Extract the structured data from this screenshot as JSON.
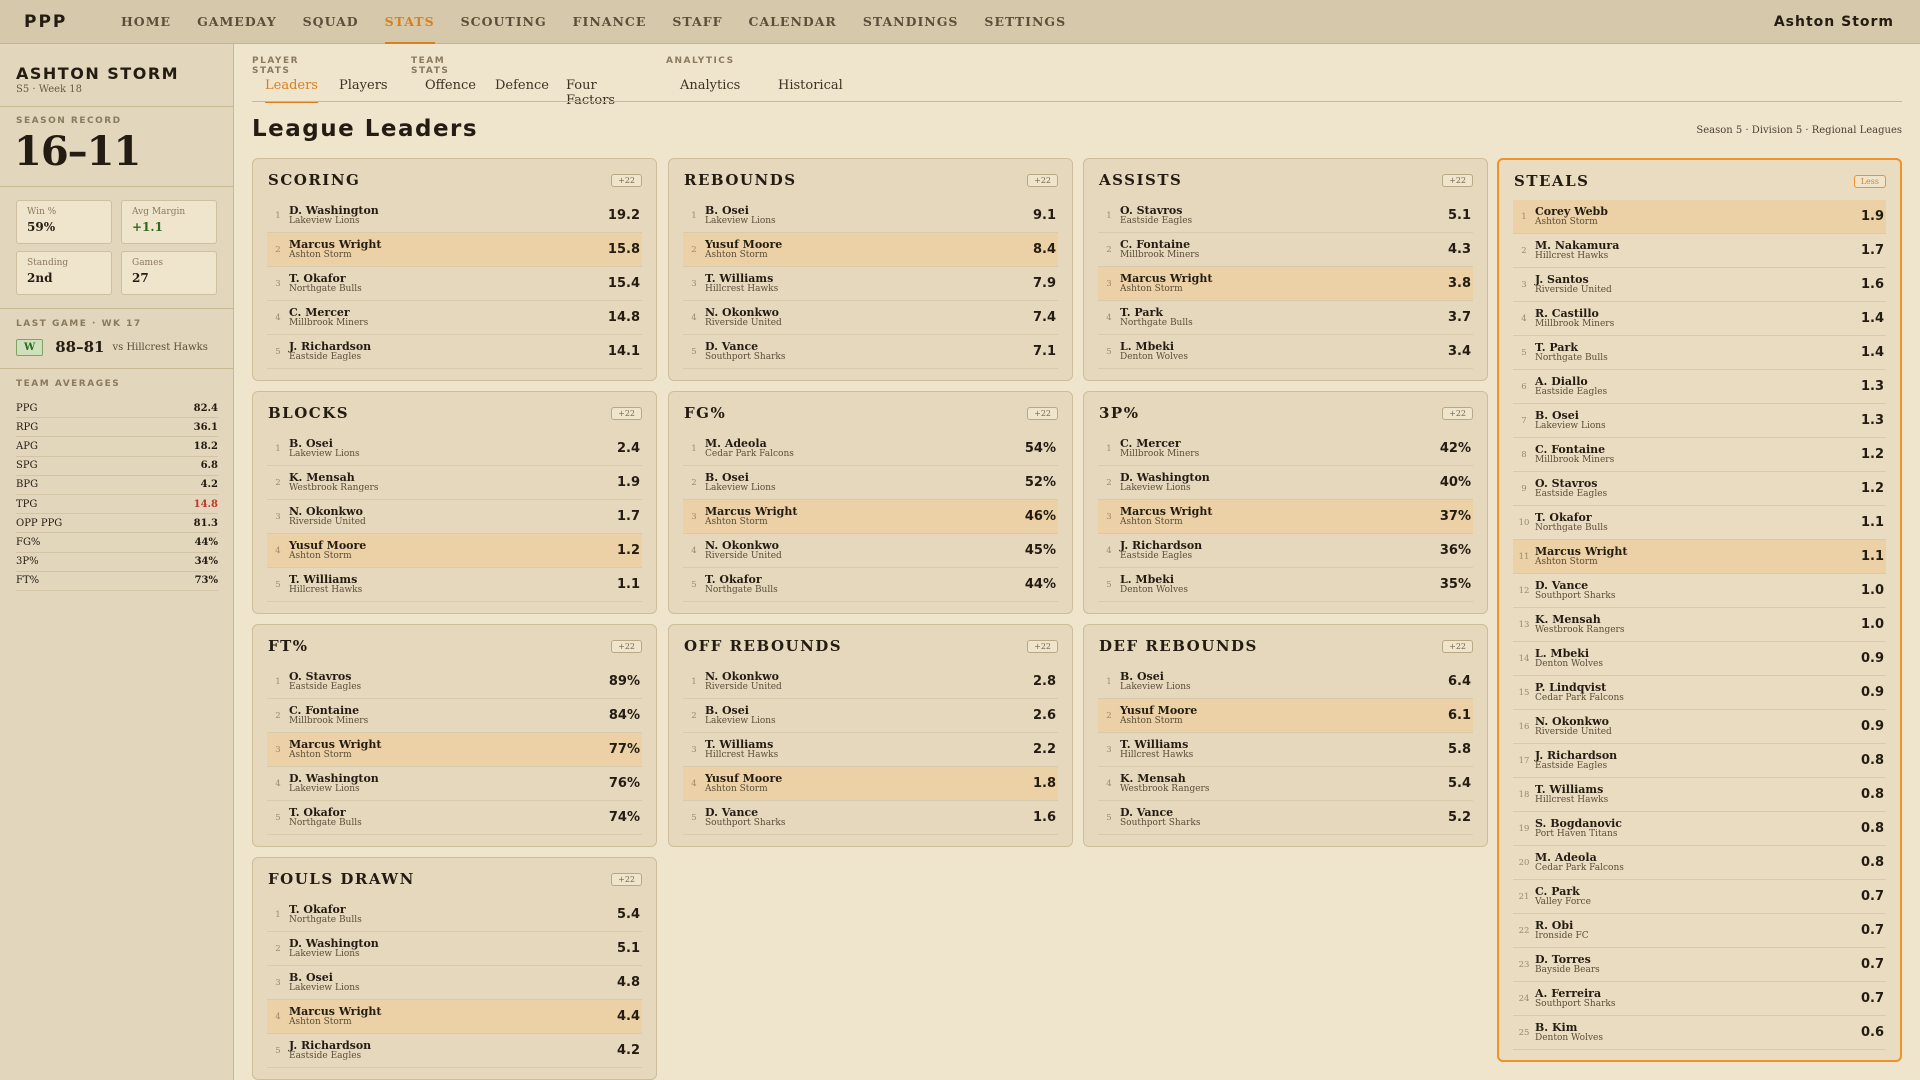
{
  "app": {
    "logo": "PPP",
    "user": "Ashton Storm"
  },
  "nav": [
    "HOME",
    "GAMEDAY",
    "SQUAD",
    "STATS",
    "SCOUTING",
    "FINANCE",
    "STAFF",
    "CALENDAR",
    "STANDINGS",
    "SETTINGS"
  ],
  "sidebar": {
    "team": "ASHTON STORM",
    "sub": "S5 · Week 18",
    "record_label": "SEASON RECORD",
    "record": "16–11",
    "stats": [
      {
        "label": "Win %",
        "value": "59%"
      },
      {
        "label": "Avg Margin",
        "value": "+1.1"
      },
      {
        "label": "Standing",
        "value": "2nd"
      },
      {
        "label": "Games",
        "value": "27"
      }
    ],
    "last_game_label": "LAST GAME · WK 17",
    "last_game": {
      "result": "W",
      "score": "88–81",
      "opponent": "vs Hillcrest Hawks"
    },
    "averages_label": "TEAM AVERAGES",
    "averages": [
      {
        "k": "PPG",
        "v": "82.4"
      },
      {
        "k": "RPG",
        "v": "36.1"
      },
      {
        "k": "APG",
        "v": "18.2"
      },
      {
        "k": "SPG",
        "v": "6.8"
      },
      {
        "k": "BPG",
        "v": "4.2"
      },
      {
        "k": "TPG",
        "v": "14.8"
      },
      {
        "k": "OPP PPG",
        "v": "81.3"
      },
      {
        "k": "FG%",
        "v": "44%"
      },
      {
        "k": "3P%",
        "v": "34%"
      },
      {
        "k": "FT%",
        "v": "73%"
      }
    ]
  },
  "tabs": {
    "groups": [
      "PLAYER STATS",
      "TEAM STATS",
      "ANALYTICS"
    ],
    "items": [
      "Leaders",
      "Players",
      "Offence",
      "Defence",
      "Four Factors",
      "Analytics",
      "Historical"
    ]
  },
  "page": {
    "title": "League Leaders",
    "breadcrumb": "Season 5 · Division 5 · Regional Leagues"
  },
  "colors": {
    "accent": "#d97f1e",
    "highlight_row": "#ebd1a5",
    "negative": "#c0392b",
    "positive": "#2f6a1f"
  },
  "cards": [
    {
      "title": "SCORING",
      "pill": "+22",
      "rows": [
        [
          "1",
          "D. Washington",
          "Lakeview Lions",
          "19.2",
          false
        ],
        [
          "2",
          "Marcus Wright",
          "Ashton Storm",
          "15.8",
          true
        ],
        [
          "3",
          "T. Okafor",
          "Northgate Bulls",
          "15.4",
          false
        ],
        [
          "4",
          "C. Mercer",
          "Millbrook Miners",
          "14.8",
          false
        ],
        [
          "5",
          "J. Richardson",
          "Eastside Eagles",
          "14.1",
          false
        ]
      ]
    },
    {
      "title": "REBOUNDS",
      "pill": "+22",
      "rows": [
        [
          "1",
          "B. Osei",
          "Lakeview Lions",
          "9.1",
          false
        ],
        [
          "2",
          "Yusuf Moore",
          "Ashton Storm",
          "8.4",
          true
        ],
        [
          "3",
          "T. Williams",
          "Hillcrest Hawks",
          "7.9",
          false
        ],
        [
          "4",
          "N. Okonkwo",
          "Riverside United",
          "7.4",
          false
        ],
        [
          "5",
          "D. Vance",
          "Southport Sharks",
          "7.1",
          false
        ]
      ]
    },
    {
      "title": "ASSISTS",
      "pill": "+22",
      "rows": [
        [
          "1",
          "O. Stavros",
          "Eastside Eagles",
          "5.1",
          false
        ],
        [
          "2",
          "C. Fontaine",
          "Millbrook Miners",
          "4.3",
          false
        ],
        [
          "3",
          "Marcus Wright",
          "Ashton Storm",
          "3.8",
          true
        ],
        [
          "4",
          "T. Park",
          "Northgate Bulls",
          "3.7",
          false
        ],
        [
          "5",
          "L. Mbeki",
          "Denton Wolves",
          "3.4",
          false
        ]
      ]
    },
    {
      "title": "BLOCKS",
      "pill": "+22",
      "rows": [
        [
          "1",
          "B. Osei",
          "Lakeview Lions",
          "2.4",
          false
        ],
        [
          "2",
          "K. Mensah",
          "Westbrook Rangers",
          "1.9",
          false
        ],
        [
          "3",
          "N. Okonkwo",
          "Riverside United",
          "1.7",
          false
        ],
        [
          "4",
          "Yusuf Moore",
          "Ashton Storm",
          "1.2",
          true
        ],
        [
          "5",
          "T. Williams",
          "Hillcrest Hawks",
          "1.1",
          false
        ]
      ]
    },
    {
      "title": "FG%",
      "pill": "+22",
      "rows": [
        [
          "1",
          "M. Adeola",
          "Cedar Park Falcons",
          "54%",
          false
        ],
        [
          "2",
          "B. Osei",
          "Lakeview Lions",
          "52%",
          false
        ],
        [
          "3",
          "Marcus Wright",
          "Ashton Storm",
          "46%",
          true
        ],
        [
          "4",
          "N. Okonkwo",
          "Riverside United",
          "45%",
          false
        ],
        [
          "5",
          "T. Okafor",
          "Northgate Bulls",
          "44%",
          false
        ]
      ]
    },
    {
      "title": "3P%",
      "pill": "+22",
      "rows": [
        [
          "1",
          "C. Mercer",
          "Millbrook Miners",
          "42%",
          false
        ],
        [
          "2",
          "D. Washington",
          "Lakeview Lions",
          "40%",
          false
        ],
        [
          "3",
          "Marcus Wright",
          "Ashton Storm",
          "37%",
          true
        ],
        [
          "4",
          "J. Richardson",
          "Eastside Eagles",
          "36%",
          false
        ],
        [
          "5",
          "L. Mbeki",
          "Denton Wolves",
          "35%",
          false
        ]
      ]
    },
    {
      "title": "FT%",
      "pill": "+22",
      "rows": [
        [
          "1",
          "O. Stavros",
          "Eastside Eagles",
          "89%",
          false
        ],
        [
          "2",
          "C. Fontaine",
          "Millbrook Miners",
          "84%",
          false
        ],
        [
          "3",
          "Marcus Wright",
          "Ashton Storm",
          "77%",
          true
        ],
        [
          "4",
          "D. Washington",
          "Lakeview Lions",
          "76%",
          false
        ],
        [
          "5",
          "T. Okafor",
          "Northgate Bulls",
          "74%",
          false
        ]
      ]
    },
    {
      "title": "OFF REBOUNDS",
      "pill": "+22",
      "rows": [
        [
          "1",
          "N. Okonkwo",
          "Riverside United",
          "2.8",
          false
        ],
        [
          "2",
          "B. Osei",
          "Lakeview Lions",
          "2.6",
          false
        ],
        [
          "3",
          "T. Williams",
          "Hillcrest Hawks",
          "2.2",
          false
        ],
        [
          "4",
          "Yusuf Moore",
          "Ashton Storm",
          "1.8",
          true
        ],
        [
          "5",
          "D. Vance",
          "Southport Sharks",
          "1.6",
          false
        ]
      ]
    },
    {
      "title": "DEF REBOUNDS",
      "pill": "+22",
      "rows": [
        [
          "1",
          "B. Osei",
          "Lakeview Lions",
          "6.4",
          false
        ],
        [
          "2",
          "Yusuf Moore",
          "Ashton Storm",
          "6.1",
          true
        ],
        [
          "3",
          "T. Williams",
          "Hillcrest Hawks",
          "5.8",
          false
        ],
        [
          "4",
          "K. Mensah",
          "Westbrook Rangers",
          "5.4",
          false
        ],
        [
          "5",
          "D. Vance",
          "Southport Sharks",
          "5.2",
          false
        ]
      ]
    },
    {
      "title": "FOULS DRAWN",
      "pill": "+22",
      "rows": [
        [
          "1",
          "T. Okafor",
          "Northgate Bulls",
          "5.4",
          false
        ],
        [
          "2",
          "D. Washington",
          "Lakeview Lions",
          "5.1",
          false
        ],
        [
          "3",
          "B. Osei",
          "Lakeview Lions",
          "4.8",
          false
        ],
        [
          "4",
          "Marcus Wright",
          "Ashton Storm",
          "4.4",
          true
        ],
        [
          "5",
          "J. Richardson",
          "Eastside Eagles",
          "4.2",
          false
        ]
      ]
    }
  ],
  "steals": {
    "title": "STEALS",
    "pill": "Less",
    "rows": [
      [
        "1",
        "Corey Webb",
        "Ashton Storm",
        "1.9",
        true
      ],
      [
        "2",
        "M. Nakamura",
        "Hillcrest Hawks",
        "1.7",
        false
      ],
      [
        "3",
        "J. Santos",
        "Riverside United",
        "1.6",
        false
      ],
      [
        "4",
        "R. Castillo",
        "Millbrook Miners",
        "1.4",
        false
      ],
      [
        "5",
        "T. Park",
        "Northgate Bulls",
        "1.4",
        false
      ],
      [
        "6",
        "A. Diallo",
        "Eastside Eagles",
        "1.3",
        false
      ],
      [
        "7",
        "B. Osei",
        "Lakeview Lions",
        "1.3",
        false
      ],
      [
        "8",
        "C. Fontaine",
        "Millbrook Miners",
        "1.2",
        false
      ],
      [
        "9",
        "O. Stavros",
        "Eastside Eagles",
        "1.2",
        false
      ],
      [
        "10",
        "T. Okafor",
        "Northgate Bulls",
        "1.1",
        false
      ],
      [
        "11",
        "Marcus Wright",
        "Ashton Storm",
        "1.1",
        true
      ],
      [
        "12",
        "D. Vance",
        "Southport Sharks",
        "1.0",
        false
      ],
      [
        "13",
        "K. Mensah",
        "Westbrook Rangers",
        "1.0",
        false
      ],
      [
        "14",
        "L. Mbeki",
        "Denton Wolves",
        "0.9",
        false
      ],
      [
        "15",
        "P. Lindqvist",
        "Cedar Park Falcons",
        "0.9",
        false
      ],
      [
        "16",
        "N. Okonkwo",
        "Riverside United",
        "0.9",
        false
      ],
      [
        "17",
        "J. Richardson",
        "Eastside Eagles",
        "0.8",
        false
      ],
      [
        "18",
        "T. Williams",
        "Hillcrest Hawks",
        "0.8",
        false
      ],
      [
        "19",
        "S. Bogdanovic",
        "Port Haven Titans",
        "0.8",
        false
      ],
      [
        "20",
        "M. Adeola",
        "Cedar Park Falcons",
        "0.8",
        false
      ],
      [
        "21",
        "C. Park",
        "Valley Force",
        "0.7",
        false
      ],
      [
        "22",
        "R. Obi",
        "Ironside FC",
        "0.7",
        false
      ],
      [
        "23",
        "D. Torres",
        "Bayside Bears",
        "0.7",
        false
      ],
      [
        "24",
        "A. Ferreira",
        "Southport Sharks",
        "0.7",
        false
      ],
      [
        "25",
        "B. Kim",
        "Denton Wolves",
        "0.6",
        false
      ]
    ]
  }
}
